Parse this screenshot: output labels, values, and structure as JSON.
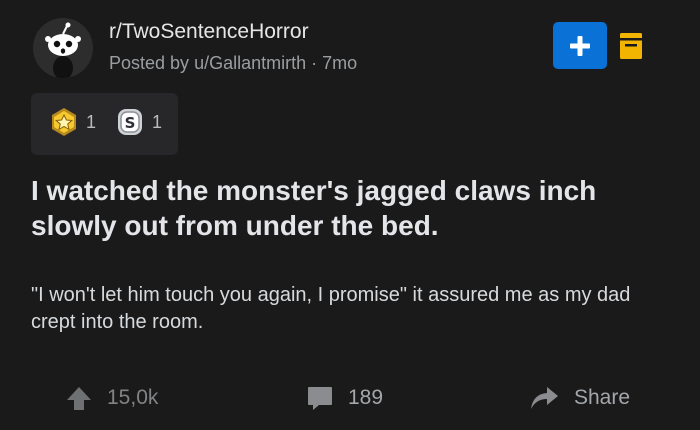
{
  "post": {
    "subreddit": "r/TwoSentenceHorror",
    "posted_by_prefix": "Posted by",
    "author": "u/Gallantmirth",
    "separator": "·",
    "age": "7mo",
    "avatar_icon": "snoo-avatar-icon",
    "title": "I watched the monster's jagged claws inch slowly out from under the bed.",
    "body": "\"I won't let him touch you again, I promise\" it assured me as my dad crept into the room."
  },
  "header_actions": {
    "join_icon": "plus-icon",
    "save_icon": "bookmark-icon",
    "accent_color": "#0a72d6",
    "save_color": "#f2b400"
  },
  "awards": [
    {
      "icon": "star-award-icon",
      "count": "1"
    },
    {
      "icon": "silver-award-icon",
      "count": "1"
    }
  ],
  "actions": {
    "upvote_icon": "upvote-arrow-icon",
    "upvote_count": "15,0k",
    "comment_icon": "comment-bubble-icon",
    "comment_count": "189",
    "share_icon": "share-arrow-icon",
    "share_label": "Share"
  }
}
